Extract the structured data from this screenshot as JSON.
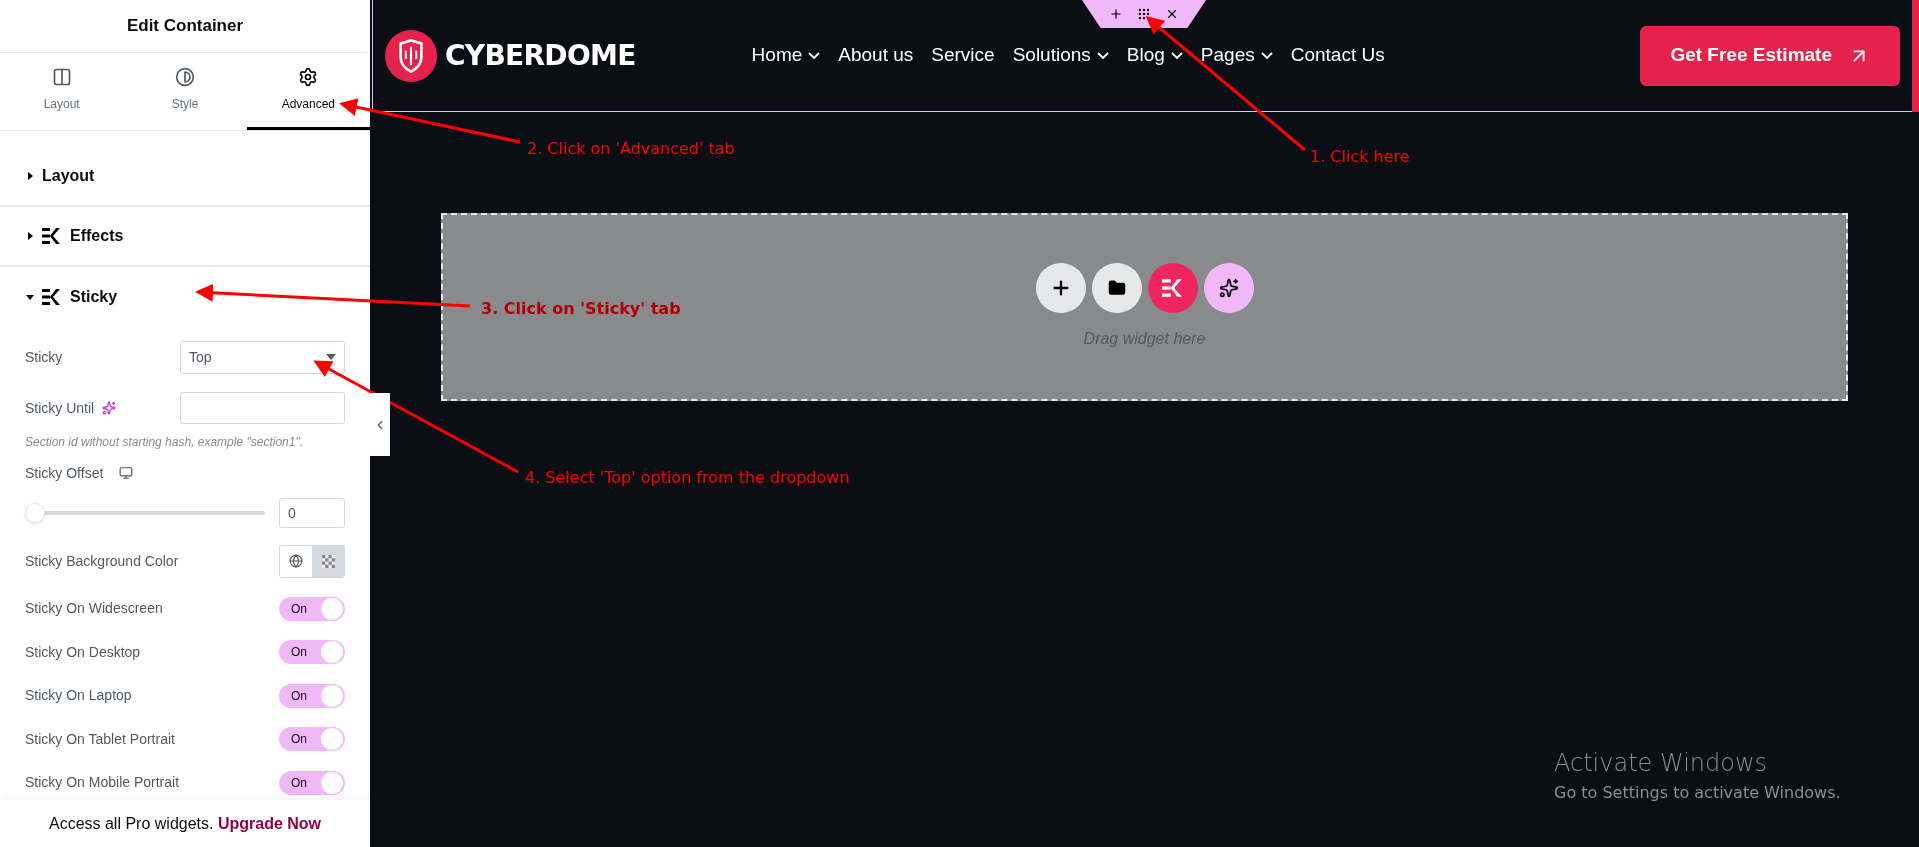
{
  "panel": {
    "title": "Edit Container",
    "tabs": [
      {
        "label": "Layout",
        "selected": false
      },
      {
        "label": "Style",
        "selected": false
      },
      {
        "label": "Advanced",
        "selected": true
      }
    ],
    "sections": [
      {
        "label": "Layout",
        "expanded": false,
        "branded": false
      },
      {
        "label": "Effects",
        "expanded": false,
        "branded": true
      },
      {
        "label": "Sticky",
        "expanded": true,
        "branded": true
      }
    ],
    "sticky": {
      "label": "Sticky",
      "value": "Top"
    },
    "sticky_until": {
      "label": "Sticky Until",
      "hint": "Section id without starting hash, example \"section1\"."
    },
    "sticky_offset": {
      "label": "Sticky Offset",
      "level": 0,
      "value": "0"
    },
    "background": {
      "label": "Sticky Background Color"
    },
    "toggles": [
      {
        "label": "Sticky On Widescreen",
        "on": true,
        "text": "On"
      },
      {
        "label": "Sticky On Desktop",
        "on": true,
        "text": "On"
      },
      {
        "label": "Sticky On Laptop",
        "on": true,
        "text": "On"
      },
      {
        "label": "Sticky On Tablet Portrait",
        "on": true,
        "text": "On"
      },
      {
        "label": "Sticky On Mobile Portrait",
        "on": true,
        "text": "On"
      }
    ],
    "promo": {
      "text": "Access all Pro widgets.",
      "link": "Upgrade Now"
    }
  },
  "site": {
    "logo": "CYBERDOME",
    "nav": [
      {
        "label": "Home",
        "dropdown": true
      },
      {
        "label": "About us",
        "dropdown": false
      },
      {
        "label": "Service",
        "dropdown": false
      },
      {
        "label": "Solutions",
        "dropdown": true
      },
      {
        "label": "Blog",
        "dropdown": true
      },
      {
        "label": "Pages",
        "dropdown": true
      },
      {
        "label": "Contact Us",
        "dropdown": false
      }
    ],
    "cta": "Get Free Estimate",
    "dropzone": {
      "hint": "Drag widget here"
    }
  },
  "annotations": [
    "1. Click here",
    "2. Click on 'Advanced' tab",
    "3. Click on 'Sticky' tab",
    "4. Select 'Top' option from the dropdown"
  ],
  "windows_notice": {
    "title": "Activate Windows",
    "text": "Go to Settings to activate Windows."
  }
}
